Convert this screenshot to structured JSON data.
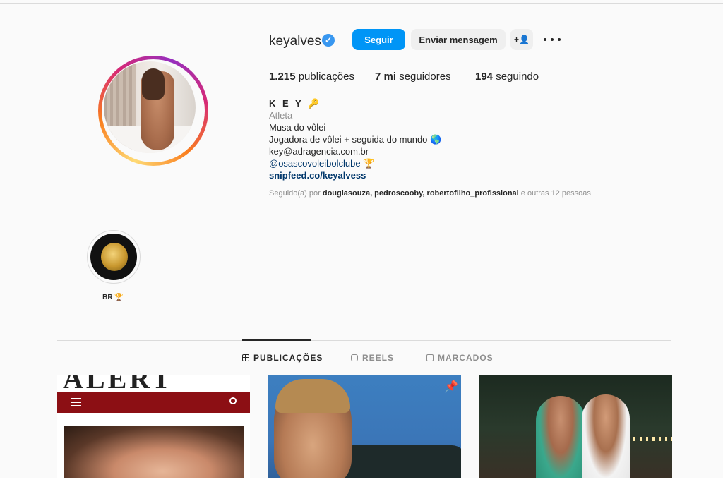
{
  "profile": {
    "username": "keyalves",
    "verified_mark": "✓",
    "buttons": {
      "follow": "Seguir",
      "message": "Enviar mensagem",
      "add_user": "+👤"
    },
    "stats": {
      "posts_count": "1.215",
      "posts_label": "publicações",
      "followers_count": "7 mi",
      "followers_label": "seguidores",
      "following_count": "194",
      "following_label": "seguindo"
    },
    "bio": {
      "name": "K E Y 🔑",
      "category": "Atleta",
      "line1": "Musa do vôlei ",
      "line2": "Jogadora de vôlei + seguida do mundo 🌎",
      "line3": "key@adragencia.com.br",
      "mention": "@osascovoleibolclube 🏆",
      "link": "snipfeed.co/keyalvess"
    },
    "followed_by": {
      "prefix": "Seguido(a) por",
      "users": "douglasouza, pedroscooby, robertofilho_profissional",
      "suffix": "e outras 12 pessoas"
    }
  },
  "highlights": [
    {
      "label": "BR 🏆"
    }
  ],
  "tabs": [
    {
      "label": "PUBLICAÇÕES",
      "active": true
    },
    {
      "label": "REELS",
      "active": false
    },
    {
      "label": "MARCADOS",
      "active": false
    }
  ],
  "posts": [
    {
      "masthead": "ALERT"
    },
    {
      "pinned": true
    },
    {}
  ],
  "icons": {
    "verified": "verified-badge-icon",
    "more": "more-options-icon",
    "pin": "pin-icon"
  },
  "colors": {
    "accent": "#0095f6",
    "verified": "#3897f0",
    "link": "#00376b",
    "muted": "#8e8e8e"
  }
}
